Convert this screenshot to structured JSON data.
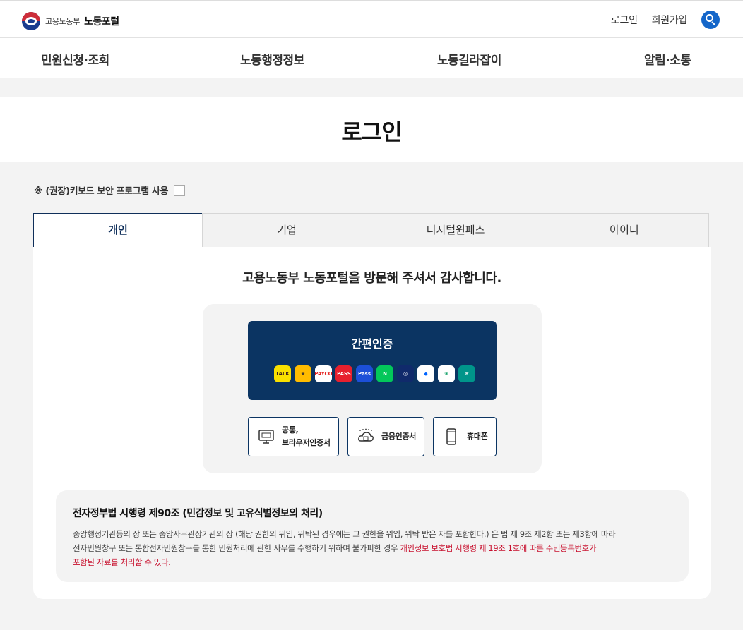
{
  "header": {
    "ministry": "고용노동부",
    "site_name": "노동포털",
    "links": [
      "로그인",
      "회원가입"
    ]
  },
  "gnb": [
    "민원신청·조회",
    "노동행정정보",
    "노동길라잡이",
    "알림·소통"
  ],
  "page_title": "로그인",
  "keyboard_option": "※ (권장)키보드 보안 프로그램 사용",
  "tabs": [
    "개인",
    "기업",
    "디지털원패스",
    "아이디"
  ],
  "active_tab": "개인",
  "welcome": "고용노동부 노동포털을 방문해 주셔서 감사합니다.",
  "simple_auth": {
    "title": "간편인증",
    "providers": [
      {
        "name": "kakao-talk",
        "text": "TALK",
        "bg": "#f9e000",
        "fg": "#3a1d1d"
      },
      {
        "name": "kb",
        "text": "★",
        "bg": "#ffbc00",
        "fg": "#4a3b2a"
      },
      {
        "name": "payco",
        "text": "PAYCO",
        "bg": "#fff",
        "fg": "#e4201e"
      },
      {
        "name": "pass",
        "text": "PASS",
        "bg": "#e7202e",
        "fg": "#fff"
      },
      {
        "name": "samsung-pass",
        "text": "Pass",
        "bg": "#1c4fd8",
        "fg": "#fff"
      },
      {
        "name": "naver",
        "text": "N",
        "bg": "#03c75a",
        "fg": "#fff"
      },
      {
        "name": "shinhan",
        "text": "◎",
        "bg": "#102a6b",
        "fg": "#fff"
      },
      {
        "name": "toss",
        "text": "◆",
        "bg": "#fff",
        "fg": "#0064ff"
      },
      {
        "name": "nh",
        "text": "❀",
        "bg": "#fff",
        "fg": "#1aa36d"
      },
      {
        "name": "hana",
        "text": "ㅎ",
        "bg": "#00958a",
        "fg": "#fff"
      }
    ]
  },
  "methods": {
    "common": [
      "공통,",
      "브라우저인증서"
    ],
    "financial": "금융인증서",
    "mobile": "휴대폰"
  },
  "notice": {
    "title": "전자정부법 시행령 제90조 (민감정보 및 고유식별정보의 처리)",
    "line1": "중앙행정기관등의 장 또는 중앙사무관장기관의 장 (해당 권한의 위임, 위탁된 경우에는 그 권한을 위임, 위탁 받은 자를 포함한다.) 은 법 제 9조 제2항 또는 제3항에 따라",
    "line2_normal": "전자민원창구 또는 통합전자민원창구를 통한 민원처리에 관한 사무를 수행하기 위하여 불가피한 경우 ",
    "line2_red": "개인정보 보호법 시행령 제 19조 1호에 따른 주민등록번호가",
    "line3_red": "포함된 자료를 처리할 수 있다."
  }
}
